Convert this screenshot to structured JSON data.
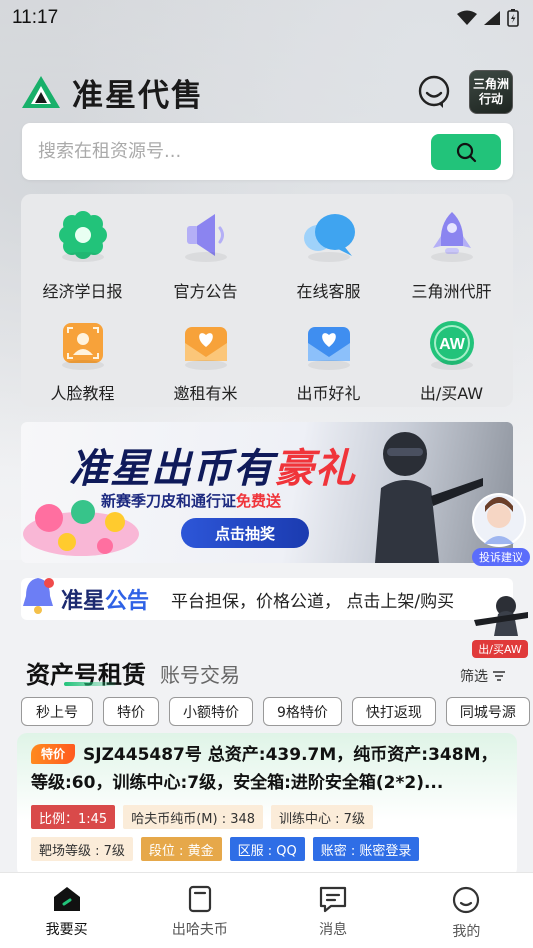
{
  "status_bar": {
    "time": "11:17"
  },
  "brand": {
    "name": "准星代售",
    "game_badge": "三角洲\n行动"
  },
  "search": {
    "placeholder": "搜索在租资源号..."
  },
  "menu": {
    "items": [
      {
        "label": "经济学日报",
        "icon": "gear-flower-icon",
        "color": "#22c37a"
      },
      {
        "label": "官方公告",
        "icon": "speaker-icon",
        "color": "#8b84f0"
      },
      {
        "label": "在线客服",
        "icon": "chat-bubbles-icon",
        "color": "#3fa4f0"
      },
      {
        "label": "三角洲代肝",
        "icon": "rocket-icon",
        "color": "#8b84f0"
      },
      {
        "label": "人脸教程",
        "icon": "face-scan-icon",
        "color": "#f7a23a"
      },
      {
        "label": "邀租有米",
        "icon": "heart-envelope-icon",
        "color": "#f7a23a"
      },
      {
        "label": "出币好礼",
        "icon": "gift-envelope-icon",
        "color": "#3f8ef0"
      },
      {
        "label": "出/买AW",
        "icon": "aw-coin-icon",
        "color": "#22c37a"
      }
    ]
  },
  "banner": {
    "title_a": "准星出币有",
    "title_b": "豪礼",
    "subtitle_a": "新赛季刀皮和通行证",
    "subtitle_b": "免费送",
    "cta": "点击抽奖",
    "service_label": "投诉建议"
  },
  "notice": {
    "tag_a": "准星",
    "tag_b": "公告",
    "text": "平台担保，价格公道， 点击上架/购买",
    "floating_label": "出/买AW"
  },
  "tabs": {
    "active": "资产号租赁",
    "inactive": "账号交易",
    "filter": "筛选"
  },
  "chips": [
    "秒上号",
    "特价",
    "小额特价",
    "9格特价",
    "快打返现",
    "同城号源"
  ],
  "listing": {
    "badge": "特价",
    "title": "SJZ445487号 总资产:439.7M，纯币资产:348M，等级:60，训练中心:7级，安全箱:进阶安全箱(2*2)...",
    "tags_row1": [
      "比例：1:45",
      "哈夫币纯币(M) : 348",
      "训练中心 : 7级"
    ],
    "tags_row2": [
      "靶场等级 : 7级",
      "段位 : 黄金",
      "区服 : QQ",
      "账密 : 账密登录"
    ]
  },
  "bottom_nav": [
    {
      "label": "我要买",
      "icon": "home-icon",
      "active": true
    },
    {
      "label": "出哈夫币",
      "icon": "phone-box-icon",
      "active": false
    },
    {
      "label": "消息",
      "icon": "message-icon",
      "active": false
    },
    {
      "label": "我的",
      "icon": "profile-face-icon",
      "active": false
    }
  ]
}
